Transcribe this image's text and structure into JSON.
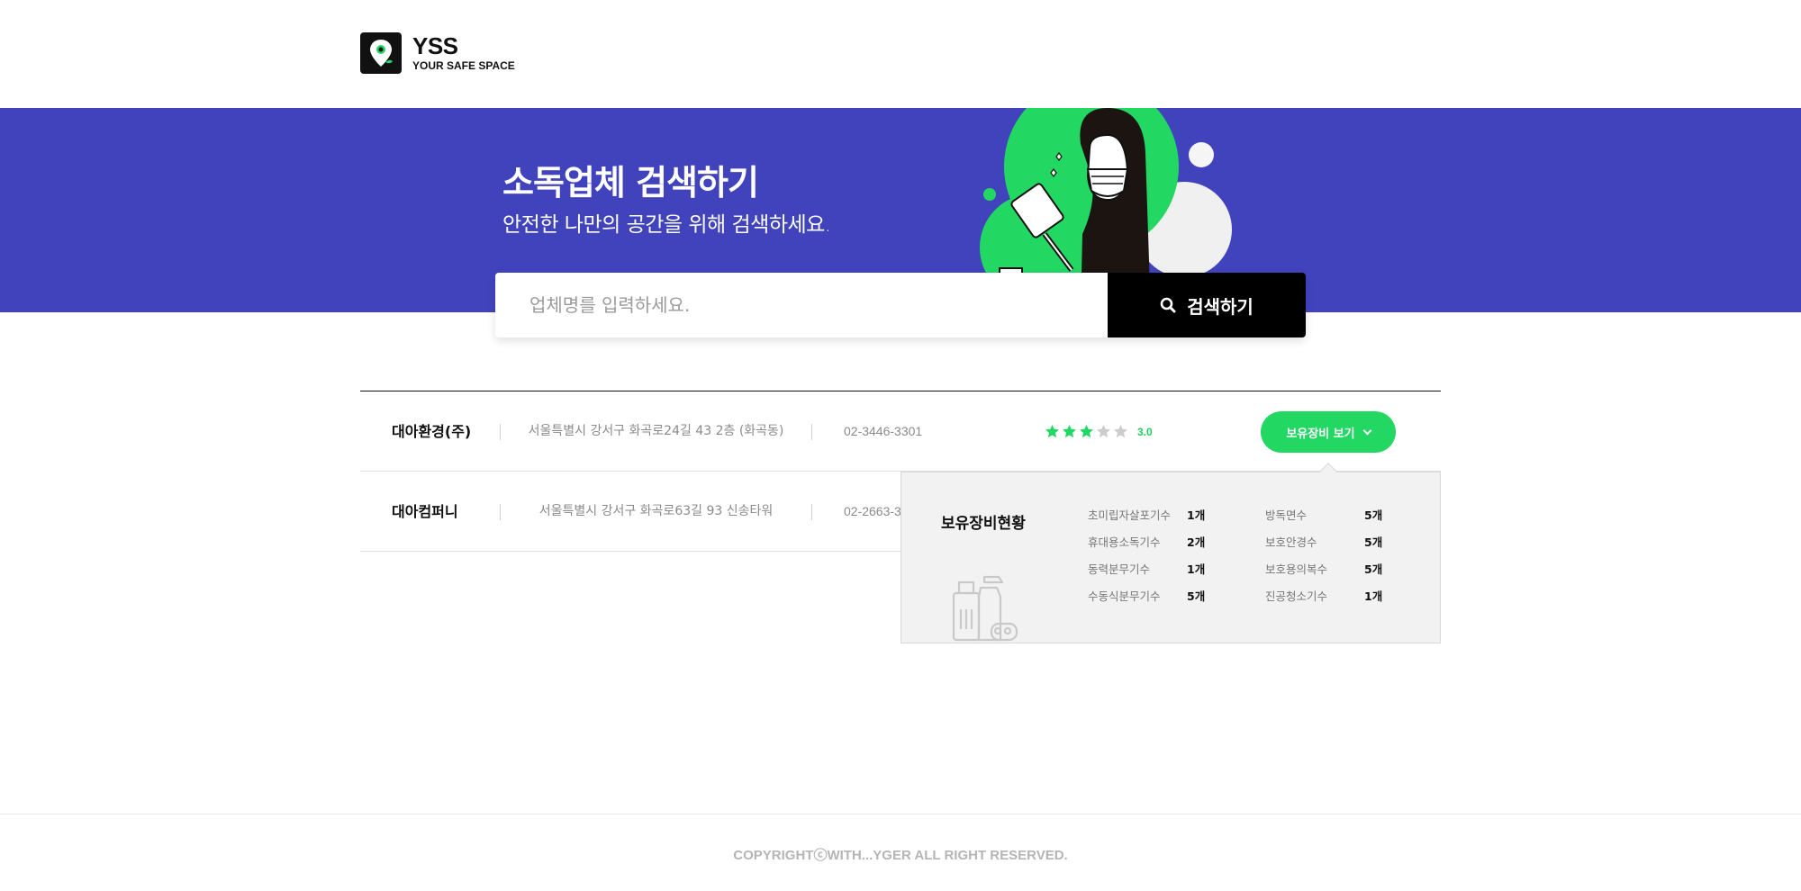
{
  "header": {
    "logo_title": "YSS",
    "logo_subtitle": "YOUR SAFE SPACE"
  },
  "hero": {
    "title": "소독업체 검색하기",
    "subtitle": "안전한 나만의 공간을 위해 검색하세요."
  },
  "search": {
    "placeholder": "업체명를 입력하세요.",
    "button_label": "검색하기"
  },
  "colors": {
    "hero_bg": "#4143bd",
    "accent_green": "#22d863",
    "search_button_bg": "#000000"
  },
  "results": [
    {
      "name": "대아환경(주)",
      "address": "서울특별시 강서구 화곡로24길 43 2층 (화곡동)",
      "phone": "02-3446-3301",
      "rating": 3,
      "rating_text": "3.0",
      "equip_button_label": "보유장비 보기"
    },
    {
      "name": "대아컴퍼니",
      "address": "서울특별시 강서구 화곡로63길 93 신송타워",
      "phone": "02-2663-3",
      "rating": null,
      "rating_text": "",
      "equip_button_label": ""
    }
  ],
  "equipment_popup": {
    "title": "보유장비현황",
    "items": [
      {
        "name": "초미립자살포기수",
        "count": "1개"
      },
      {
        "name": "방독면수",
        "count": "5개"
      },
      {
        "name": "휴대용소독기수",
        "count": "2개"
      },
      {
        "name": "보호안경수",
        "count": "5개"
      },
      {
        "name": "동력분무기수",
        "count": "1개"
      },
      {
        "name": "보호용의복수",
        "count": "5개"
      },
      {
        "name": "수동식분무기수",
        "count": "5개"
      },
      {
        "name": "진공청소기수",
        "count": "1개"
      }
    ]
  },
  "icons": {
    "logo": "map-pin-icon",
    "search": "search-icon",
    "chevron": "chevron-down-icon",
    "star": "star-icon",
    "cleaning_supplies": "cleaning-supplies-icon"
  },
  "footer": {
    "copyright": "COPYRIGHTⓒWITH...YGER ALL RIGHT RESERVED."
  }
}
